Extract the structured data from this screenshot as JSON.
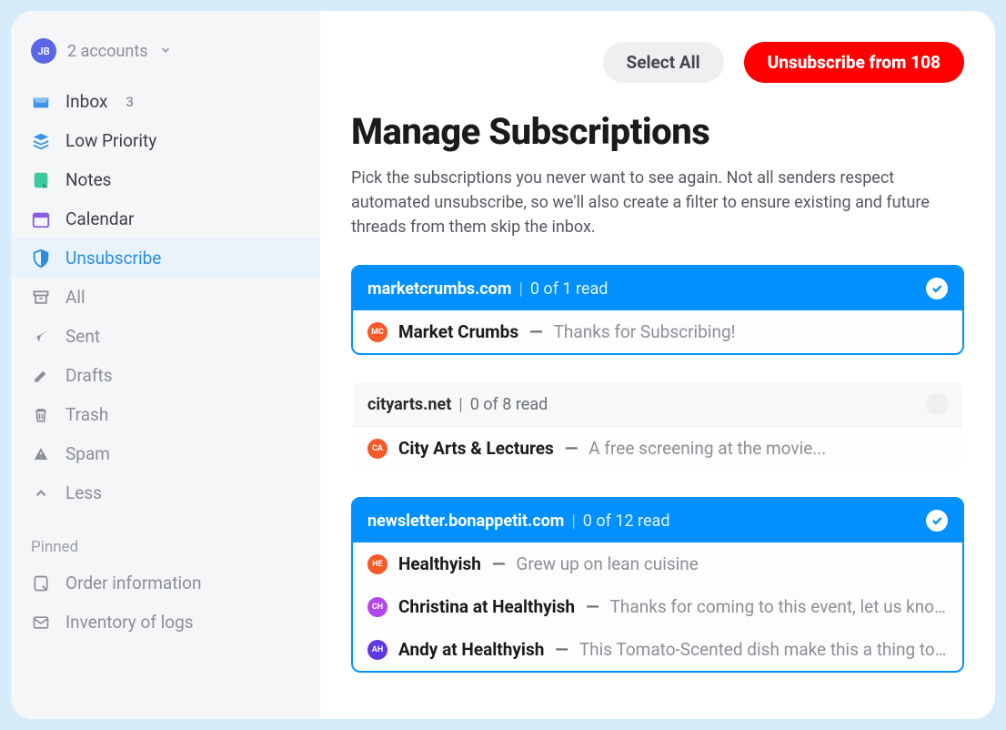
{
  "account": {
    "initials": "JB",
    "label": "2 accounts"
  },
  "sidebar": {
    "items": [
      {
        "id": "inbox",
        "label": "Inbox",
        "badge": "3"
      },
      {
        "id": "lowpriority",
        "label": "Low Priority"
      },
      {
        "id": "notes",
        "label": "Notes"
      },
      {
        "id": "calendar",
        "label": "Calendar"
      },
      {
        "id": "unsubscribe",
        "label": "Unsubscribe"
      },
      {
        "id": "all",
        "label": "All"
      },
      {
        "id": "sent",
        "label": "Sent"
      },
      {
        "id": "drafts",
        "label": "Drafts"
      },
      {
        "id": "trash",
        "label": "Trash"
      },
      {
        "id": "spam",
        "label": "Spam"
      },
      {
        "id": "less",
        "label": "Less"
      }
    ],
    "pinned_label": "Pinned",
    "pinned": [
      {
        "id": "order-info",
        "label": "Order information"
      },
      {
        "id": "inventory-logs",
        "label": "Inventory of logs"
      }
    ]
  },
  "toolbar": {
    "select_all": "Select All",
    "unsubscribe": "Unsubscribe  from 108"
  },
  "page": {
    "title": "Manage Subscriptions",
    "desc": "Pick the subscriptions you never want to see again. Not all senders respect automated unsubscribe, so we'll also create a filter to ensure existing and future threads from them skip the inbox."
  },
  "groups": [
    {
      "domain": "marketcrumbs.com",
      "meta": "0 of 1 read",
      "selected": true,
      "rows": [
        {
          "avatar": "MC",
          "color": "#f45927",
          "sender": "Market Crumbs",
          "subject": "Thanks for Subscribing!"
        }
      ]
    },
    {
      "domain": "cityarts.net",
      "meta": "0 of 8 read",
      "selected": false,
      "rows": [
        {
          "avatar": "CA",
          "color": "#f45927",
          "sender": "City Arts & Lectures",
          "subject": "A free screening at the movie..."
        }
      ]
    },
    {
      "domain": "newsletter.bonappetit.com",
      "meta": "0 of 12 read",
      "selected": true,
      "rows": [
        {
          "avatar": "HE",
          "color": "#f45927",
          "sender": "Healthyish",
          "subject": "Grew up on lean cuisine"
        },
        {
          "avatar": "CH",
          "color": "#b146eb",
          "sender": "Christina at Healthyish",
          "subject": "Thanks for coming to this event, let us know..."
        },
        {
          "avatar": "AH",
          "color": "#6037e0",
          "sender": "Andy at Healthyish",
          "subject": "This Tomato-Scented dish make this a thing to a..."
        }
      ]
    }
  ]
}
